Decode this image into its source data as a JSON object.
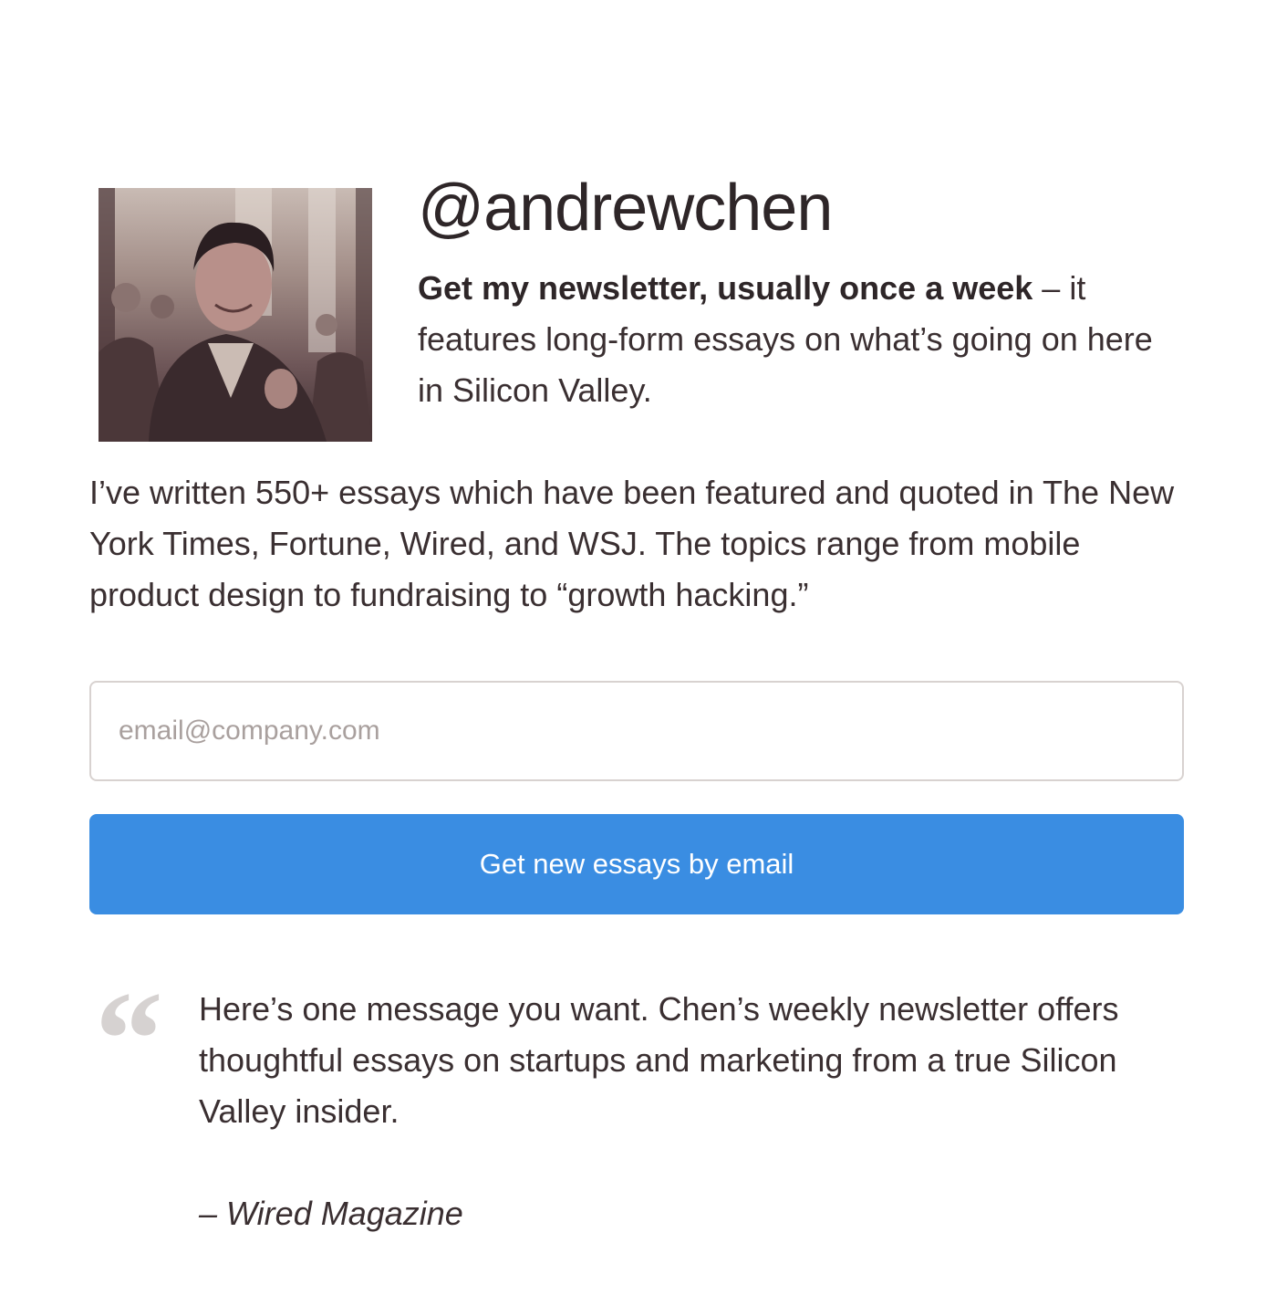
{
  "profile": {
    "handle": "@andrewchen",
    "avatar_alt": "avatar"
  },
  "intro": {
    "bold": "Get my newsletter, usually once a week",
    "rest": " – it features long-form essays on what’s going on here in Silicon Valley."
  },
  "essays": {
    "text": "I’ve written 550+ essays which have been featured and quoted in The New York Times, Fortune, Wired, and WSJ. The topics range from mobile product design to fundraising to “growth hacking.”"
  },
  "signup": {
    "email_placeholder": "email@company.com",
    "button_label": "Get new essays by email",
    "button_color": "#3a8de2"
  },
  "testimonial": {
    "quote_glyph": "“",
    "text": "Here’s one message you want. Chen’s weekly newsletter offers thoughtful essays on startups and marketing from a true Silicon Valley insider.",
    "source": "– Wired Magazine"
  }
}
